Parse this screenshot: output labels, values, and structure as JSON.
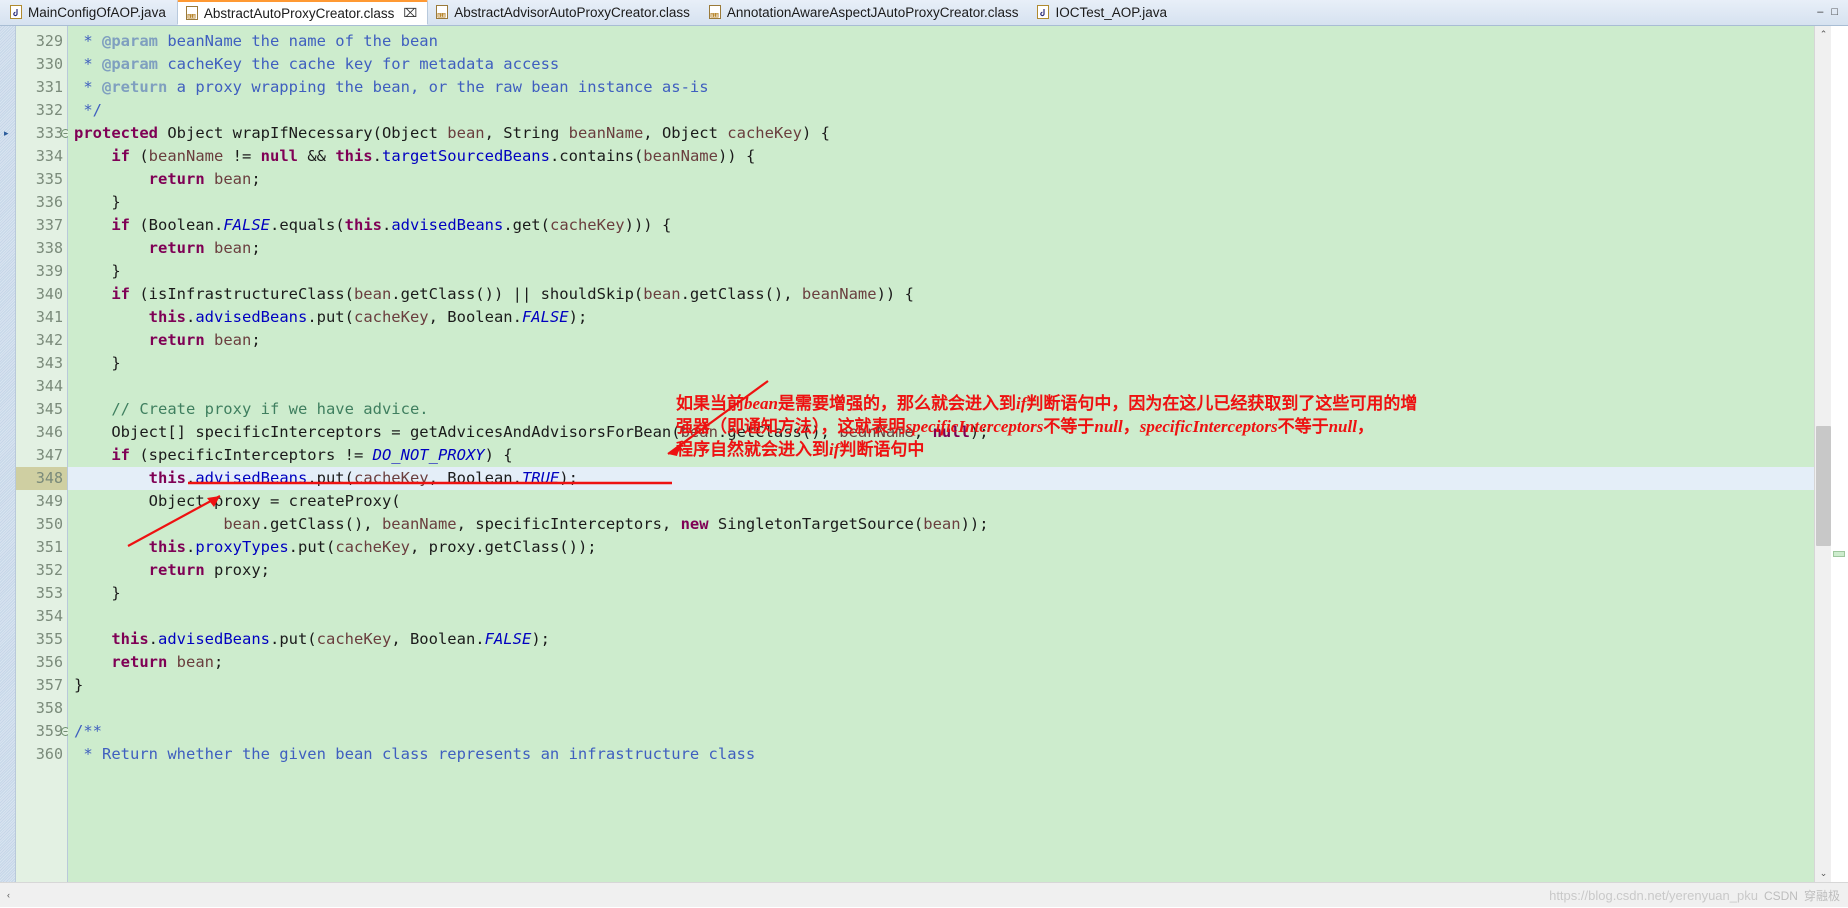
{
  "window": {
    "minimize_label": "–",
    "maximize_label": "□"
  },
  "tabs": [
    {
      "label": "MainConfigOfAOP.java",
      "icon": "java-file-icon",
      "active": false,
      "closable": false
    },
    {
      "label": "AbstractAutoProxyCreator.class",
      "icon": "class-file-icon",
      "active": true,
      "closable": true,
      "close_glyph": "⌧"
    },
    {
      "label": "AbstractAdvisorAutoProxyCreator.class",
      "icon": "class-file-icon",
      "active": false,
      "closable": false
    },
    {
      "label": "AnnotationAwareAspectJAutoProxyCreator.class",
      "icon": "class-file-icon",
      "active": false,
      "closable": false
    },
    {
      "label": "IOCTest_AOP.java",
      "icon": "java-file-icon",
      "active": false,
      "closable": false
    }
  ],
  "editor": {
    "language": "java",
    "first_line": 329,
    "highlighted_line": 348,
    "lines": [
      {
        "n": 329,
        "fold": false,
        "tokens": [
          {
            "t": " * ",
            "c": "jdoc"
          },
          {
            "t": "@param",
            "c": "jtag"
          },
          {
            "t": " beanName the name of the bean",
            "c": "jdoc"
          }
        ]
      },
      {
        "n": 330,
        "fold": false,
        "tokens": [
          {
            "t": " * ",
            "c": "jdoc"
          },
          {
            "t": "@param",
            "c": "jtag"
          },
          {
            "t": " cacheKey the cache key for metadata access",
            "c": "jdoc"
          }
        ]
      },
      {
        "n": 331,
        "fold": false,
        "tokens": [
          {
            "t": " * ",
            "c": "jdoc"
          },
          {
            "t": "@return",
            "c": "jtag"
          },
          {
            "t": " a proxy wrapping the bean, or the raw bean instance as-is",
            "c": "jdoc"
          }
        ]
      },
      {
        "n": 332,
        "fold": false,
        "tokens": [
          {
            "t": " */",
            "c": "jdoc"
          }
        ]
      },
      {
        "n": 333,
        "fold": true,
        "tokens": [
          {
            "t": "protected",
            "c": "kw"
          },
          {
            "t": " Object wrapIfNecessary(Object ",
            "c": "pln"
          },
          {
            "t": "bean",
            "c": "prm"
          },
          {
            "t": ", String ",
            "c": "pln"
          },
          {
            "t": "beanName",
            "c": "prm"
          },
          {
            "t": ", Object ",
            "c": "pln"
          },
          {
            "t": "cacheKey",
            "c": "prm"
          },
          {
            "t": ") {",
            "c": "pln"
          }
        ]
      },
      {
        "n": 334,
        "fold": false,
        "tokens": [
          {
            "t": "    ",
            "c": "pln"
          },
          {
            "t": "if",
            "c": "kw"
          },
          {
            "t": " (",
            "c": "pln"
          },
          {
            "t": "beanName",
            "c": "prm"
          },
          {
            "t": " != ",
            "c": "pln"
          },
          {
            "t": "null",
            "c": "kw"
          },
          {
            "t": " && ",
            "c": "pln"
          },
          {
            "t": "this",
            "c": "kw"
          },
          {
            "t": ".",
            "c": "pln"
          },
          {
            "t": "targetSourcedBeans",
            "c": "fld"
          },
          {
            "t": ".contains(",
            "c": "pln"
          },
          {
            "t": "beanName",
            "c": "prm"
          },
          {
            "t": ")) {",
            "c": "pln"
          }
        ]
      },
      {
        "n": 335,
        "fold": false,
        "tokens": [
          {
            "t": "        ",
            "c": "pln"
          },
          {
            "t": "return",
            "c": "kw"
          },
          {
            "t": " ",
            "c": "pln"
          },
          {
            "t": "bean",
            "c": "prm"
          },
          {
            "t": ";",
            "c": "pln"
          }
        ]
      },
      {
        "n": 336,
        "fold": false,
        "tokens": [
          {
            "t": "    }",
            "c": "pln"
          }
        ]
      },
      {
        "n": 337,
        "fold": false,
        "tokens": [
          {
            "t": "    ",
            "c": "pln"
          },
          {
            "t": "if",
            "c": "kw"
          },
          {
            "t": " (Boolean.",
            "c": "pln"
          },
          {
            "t": "FALSE",
            "c": "sfld"
          },
          {
            "t": ".equals(",
            "c": "pln"
          },
          {
            "t": "this",
            "c": "kw"
          },
          {
            "t": ".",
            "c": "pln"
          },
          {
            "t": "advisedBeans",
            "c": "fld"
          },
          {
            "t": ".get(",
            "c": "pln"
          },
          {
            "t": "cacheKey",
            "c": "prm"
          },
          {
            "t": "))) {",
            "c": "pln"
          }
        ]
      },
      {
        "n": 338,
        "fold": false,
        "tokens": [
          {
            "t": "        ",
            "c": "pln"
          },
          {
            "t": "return",
            "c": "kw"
          },
          {
            "t": " ",
            "c": "pln"
          },
          {
            "t": "bean",
            "c": "prm"
          },
          {
            "t": ";",
            "c": "pln"
          }
        ]
      },
      {
        "n": 339,
        "fold": false,
        "tokens": [
          {
            "t": "    }",
            "c": "pln"
          }
        ]
      },
      {
        "n": 340,
        "fold": false,
        "tokens": [
          {
            "t": "    ",
            "c": "pln"
          },
          {
            "t": "if",
            "c": "kw"
          },
          {
            "t": " (isInfrastructureClass(",
            "c": "pln"
          },
          {
            "t": "bean",
            "c": "prm"
          },
          {
            "t": ".getClass()) || shouldSkip(",
            "c": "pln"
          },
          {
            "t": "bean",
            "c": "prm"
          },
          {
            "t": ".getClass(), ",
            "c": "pln"
          },
          {
            "t": "beanName",
            "c": "prm"
          },
          {
            "t": ")) {",
            "c": "pln"
          }
        ]
      },
      {
        "n": 341,
        "fold": false,
        "tokens": [
          {
            "t": "        ",
            "c": "pln"
          },
          {
            "t": "this",
            "c": "kw"
          },
          {
            "t": ".",
            "c": "pln"
          },
          {
            "t": "advisedBeans",
            "c": "fld"
          },
          {
            "t": ".put(",
            "c": "pln"
          },
          {
            "t": "cacheKey",
            "c": "prm"
          },
          {
            "t": ", Boolean.",
            "c": "pln"
          },
          {
            "t": "FALSE",
            "c": "sfld"
          },
          {
            "t": ");",
            "c": "pln"
          }
        ]
      },
      {
        "n": 342,
        "fold": false,
        "tokens": [
          {
            "t": "        ",
            "c": "pln"
          },
          {
            "t": "return",
            "c": "kw"
          },
          {
            "t": " ",
            "c": "pln"
          },
          {
            "t": "bean",
            "c": "prm"
          },
          {
            "t": ";",
            "c": "pln"
          }
        ]
      },
      {
        "n": 343,
        "fold": false,
        "tokens": [
          {
            "t": "    }",
            "c": "pln"
          }
        ]
      },
      {
        "n": 344,
        "fold": false,
        "tokens": [
          {
            "t": "",
            "c": "pln"
          }
        ]
      },
      {
        "n": 345,
        "fold": false,
        "tokens": [
          {
            "t": "    // Create proxy if we have advice.",
            "c": "cmt"
          }
        ]
      },
      {
        "n": 346,
        "fold": false,
        "tokens": [
          {
            "t": "    Object[] specificInterceptors = getAdvicesAndAdvisorsForBean(",
            "c": "pln"
          },
          {
            "t": "bean",
            "c": "prm"
          },
          {
            "t": ".getClass(), ",
            "c": "pln"
          },
          {
            "t": "beanName",
            "c": "prm"
          },
          {
            "t": ", ",
            "c": "pln"
          },
          {
            "t": "null",
            "c": "kw"
          },
          {
            "t": ");",
            "c": "pln"
          }
        ]
      },
      {
        "n": 347,
        "fold": false,
        "tokens": [
          {
            "t": "    ",
            "c": "pln"
          },
          {
            "t": "if",
            "c": "kw"
          },
          {
            "t": " (specificInterceptors != ",
            "c": "pln"
          },
          {
            "t": "DO_NOT_PROXY",
            "c": "sfld"
          },
          {
            "t": ") {",
            "c": "pln"
          }
        ]
      },
      {
        "n": 348,
        "fold": false,
        "hl": true,
        "tokens": [
          {
            "t": "        ",
            "c": "pln"
          },
          {
            "t": "this",
            "c": "kw"
          },
          {
            "t": ".",
            "c": "pln"
          },
          {
            "t": "advisedBeans",
            "c": "fld"
          },
          {
            "t": ".put(",
            "c": "pln"
          },
          {
            "t": "cacheKey",
            "c": "prm"
          },
          {
            "t": ", Boolean.",
            "c": "pln"
          },
          {
            "t": "TRUE",
            "c": "sfld"
          },
          {
            "t": ");",
            "c": "pln"
          }
        ]
      },
      {
        "n": 349,
        "fold": false,
        "tokens": [
          {
            "t": "        Object proxy = createProxy(",
            "c": "pln"
          }
        ]
      },
      {
        "n": 350,
        "fold": false,
        "tokens": [
          {
            "t": "                ",
            "c": "pln"
          },
          {
            "t": "bean",
            "c": "prm"
          },
          {
            "t": ".getClass(), ",
            "c": "pln"
          },
          {
            "t": "beanName",
            "c": "prm"
          },
          {
            "t": ", specificInterceptors, ",
            "c": "pln"
          },
          {
            "t": "new",
            "c": "kw"
          },
          {
            "t": " SingletonTargetSource(",
            "c": "pln"
          },
          {
            "t": "bean",
            "c": "prm"
          },
          {
            "t": "));",
            "c": "pln"
          }
        ]
      },
      {
        "n": 351,
        "fold": false,
        "tokens": [
          {
            "t": "        ",
            "c": "pln"
          },
          {
            "t": "this",
            "c": "kw"
          },
          {
            "t": ".",
            "c": "pln"
          },
          {
            "t": "proxyTypes",
            "c": "fld"
          },
          {
            "t": ".put(",
            "c": "pln"
          },
          {
            "t": "cacheKey",
            "c": "prm"
          },
          {
            "t": ", proxy.getClass());",
            "c": "pln"
          }
        ]
      },
      {
        "n": 352,
        "fold": false,
        "tokens": [
          {
            "t": "        ",
            "c": "pln"
          },
          {
            "t": "return",
            "c": "kw"
          },
          {
            "t": " proxy;",
            "c": "pln"
          }
        ]
      },
      {
        "n": 353,
        "fold": false,
        "tokens": [
          {
            "t": "    }",
            "c": "pln"
          }
        ]
      },
      {
        "n": 354,
        "fold": false,
        "tokens": [
          {
            "t": "",
            "c": "pln"
          }
        ]
      },
      {
        "n": 355,
        "fold": false,
        "tokens": [
          {
            "t": "    ",
            "c": "pln"
          },
          {
            "t": "this",
            "c": "kw"
          },
          {
            "t": ".",
            "c": "pln"
          },
          {
            "t": "advisedBeans",
            "c": "fld"
          },
          {
            "t": ".put(",
            "c": "pln"
          },
          {
            "t": "cacheKey",
            "c": "prm"
          },
          {
            "t": ", Boolean.",
            "c": "pln"
          },
          {
            "t": "FALSE",
            "c": "sfld"
          },
          {
            "t": ");",
            "c": "pln"
          }
        ]
      },
      {
        "n": 356,
        "fold": false,
        "tokens": [
          {
            "t": "    ",
            "c": "pln"
          },
          {
            "t": "return",
            "c": "kw"
          },
          {
            "t": " ",
            "c": "pln"
          },
          {
            "t": "bean",
            "c": "prm"
          },
          {
            "t": ";",
            "c": "pln"
          }
        ]
      },
      {
        "n": 357,
        "fold": false,
        "tokens": [
          {
            "t": "}",
            "c": "pln"
          }
        ]
      },
      {
        "n": 358,
        "fold": false,
        "tokens": [
          {
            "t": "",
            "c": "pln"
          }
        ]
      },
      {
        "n": 359,
        "fold": true,
        "tokens": [
          {
            "t": "/**",
            "c": "jdoc"
          }
        ]
      },
      {
        "n": 360,
        "fold": false,
        "tokens": [
          {
            "t": " * Return whether the given bean class represents an infrastructure class",
            "c": "jdoc"
          }
        ]
      }
    ]
  },
  "annotation": {
    "color": "#ee1111",
    "line1_a": "如果当前",
    "line1_em": "bean",
    "line1_b": "是需要增强的，那么就会进入到",
    "line1_em2": "if",
    "line1_c": "判断语句中，因为在这儿已经获取到了这些可用的增",
    "line2_a": "强器（即通知方法），这就表明",
    "line2_em": "specificInterceptors",
    "line2_b": "不等于",
    "line2_em2": "null",
    "line2_c": "，",
    "line2_em3": "specificInterceptors",
    "line2_d": "不等于",
    "line2_em4": "null",
    "line2_e": "，",
    "line3_a": "程序自然就会进入到",
    "line3_em": "if",
    "line3_b": "判断语句中"
  },
  "scrollbars": {
    "vertical_up_glyph": "⌃",
    "vertical_down_glyph": "⌄",
    "horizontal_left_glyph": "‹",
    "horizontal_right_glyph": "›"
  },
  "watermark": {
    "url": "https://blog.csdn.net/yerenyuan_pku",
    "brand": "CSDN",
    "brand_cn": "穿融极"
  }
}
